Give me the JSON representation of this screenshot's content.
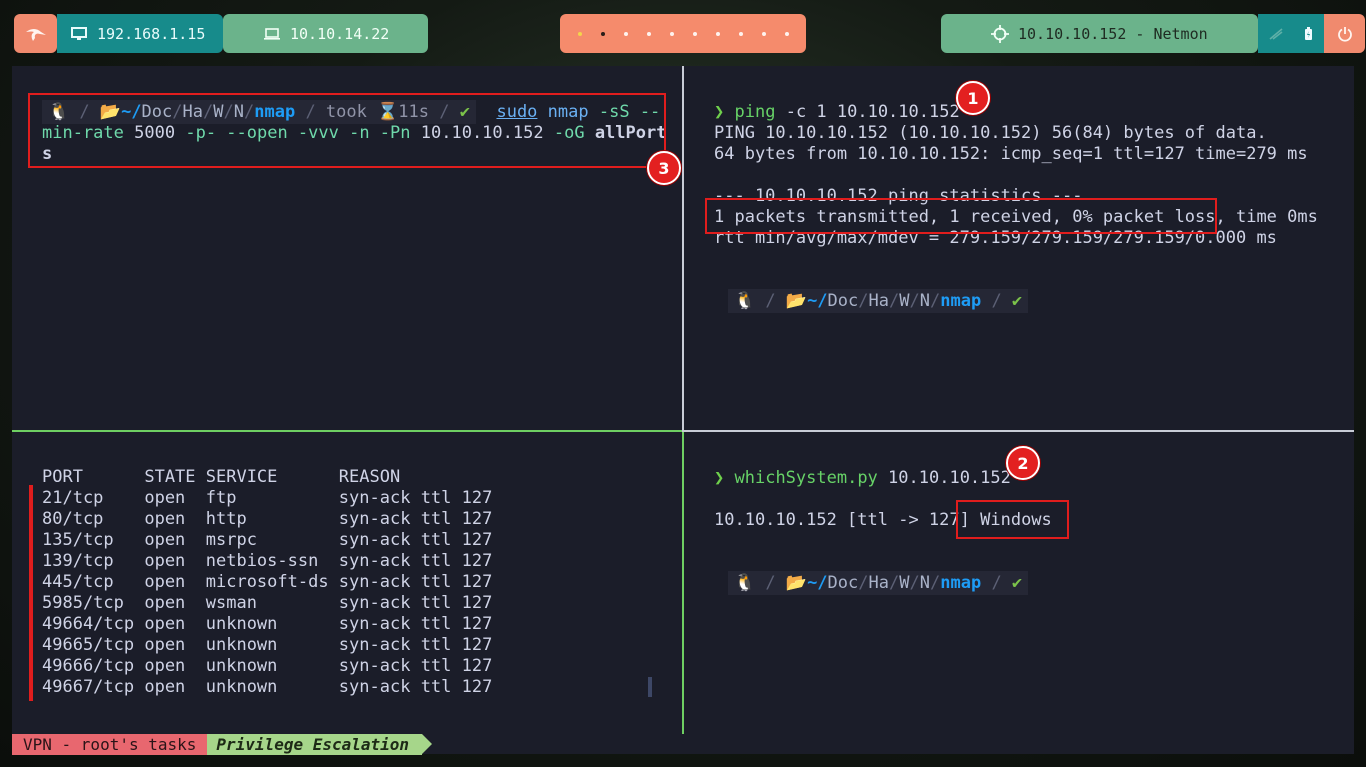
{
  "topbar": {
    "host_ip": "192.168.1.15",
    "vpn_ip": "10.10.14.22",
    "target": "10.10.10.152 - Netmon",
    "workspaces": [
      {
        "state": "urgent"
      },
      {
        "state": "active"
      },
      {
        "state": "normal"
      },
      {
        "state": "normal"
      },
      {
        "state": "normal"
      },
      {
        "state": "normal"
      },
      {
        "state": "normal"
      },
      {
        "state": "normal"
      },
      {
        "state": "normal"
      },
      {
        "state": "normal"
      }
    ],
    "icons": [
      "kali-dragon-icon",
      "monitor-icon",
      "laptop-icon",
      "crosshair-icon",
      "network-icon",
      "battery-icon",
      "power-icon"
    ]
  },
  "pane_top_left": {
    "prompt": {
      "os_icon": "🐧",
      "path_prefix": "~/",
      "path_dirs": [
        "Doc",
        "Ha",
        "W",
        "N"
      ],
      "path_last": "nmap",
      "took_label": "took",
      "took_time": "11s",
      "status": "✔"
    },
    "command": {
      "sudo": "sudo",
      "binary": "nmap",
      "flag1": "-sS --",
      "line2_flag": "min-rate",
      "line2_rate": "5000",
      "line2_flags": "-p- --open -vvv -n -Pn",
      "line2_ip": "10.10.10.152",
      "line2_oG": "-oG",
      "line2_file": "allPort",
      "line3_file": "s"
    },
    "badge": "3"
  },
  "pane_top_right": {
    "cmd_name": "ping",
    "cmd_args": "-c 1 10.10.10.152",
    "output": [
      "PING 10.10.10.152 (10.10.10.152) 56(84) bytes of data.",
      "64 bytes from 10.10.10.152: icmp_seq=1 ttl=127 time=279 ms",
      "",
      "--- 10.10.10.152 ping statistics ---",
      "1 packets transmitted, 1 received, 0% packet loss, time 0ms",
      "rtt min/avg/max/mdev = 279.159/279.159/279.159/0.000 ms"
    ],
    "prompt": {
      "os_icon": "🐧",
      "path_prefix": "~/",
      "path_dirs": [
        "Doc",
        "Ha",
        "W",
        "N"
      ],
      "path_last": "nmap",
      "status": "✔"
    },
    "badge": "1"
  },
  "pane_bottom_left": {
    "header": "PORT      STATE SERVICE      REASON",
    "rows": [
      "21/tcp    open  ftp          syn-ack ttl 127",
      "80/tcp    open  http         syn-ack ttl 127",
      "135/tcp   open  msrpc        syn-ack ttl 127",
      "139/tcp   open  netbios-ssn  syn-ack ttl 127",
      "445/tcp   open  microsoft-ds syn-ack ttl 127",
      "5985/tcp  open  wsman        syn-ack ttl 127",
      "49664/tcp open  unknown      syn-ack ttl 127",
      "49665/tcp open  unknown      syn-ack ttl 127",
      "49666/tcp open  unknown      syn-ack ttl 127",
      "49667/tcp open  unknown      syn-ack ttl 127"
    ]
  },
  "pane_bottom_right": {
    "cmd_name": "whichSystem.py",
    "cmd_args": "10.10.10.152",
    "output_prefix": "10.10.10.152 [ttl -> 127]",
    "output_os": "Windows",
    "prompt": {
      "os_icon": "🐧",
      "path_prefix": "~/",
      "path_dirs": [
        "Doc",
        "Ha",
        "W",
        "N"
      ],
      "path_last": "nmap",
      "status": "✔"
    },
    "badge": "2"
  },
  "statusbar": {
    "session": "VPN - root's tasks",
    "window": "Privilege Escalation"
  },
  "colors": {
    "terminal_bg": "#1b1d29",
    "accent_green": "#6ecf62",
    "annotation_red": "#e01d1d",
    "path_blue": "#1e9cf5"
  }
}
